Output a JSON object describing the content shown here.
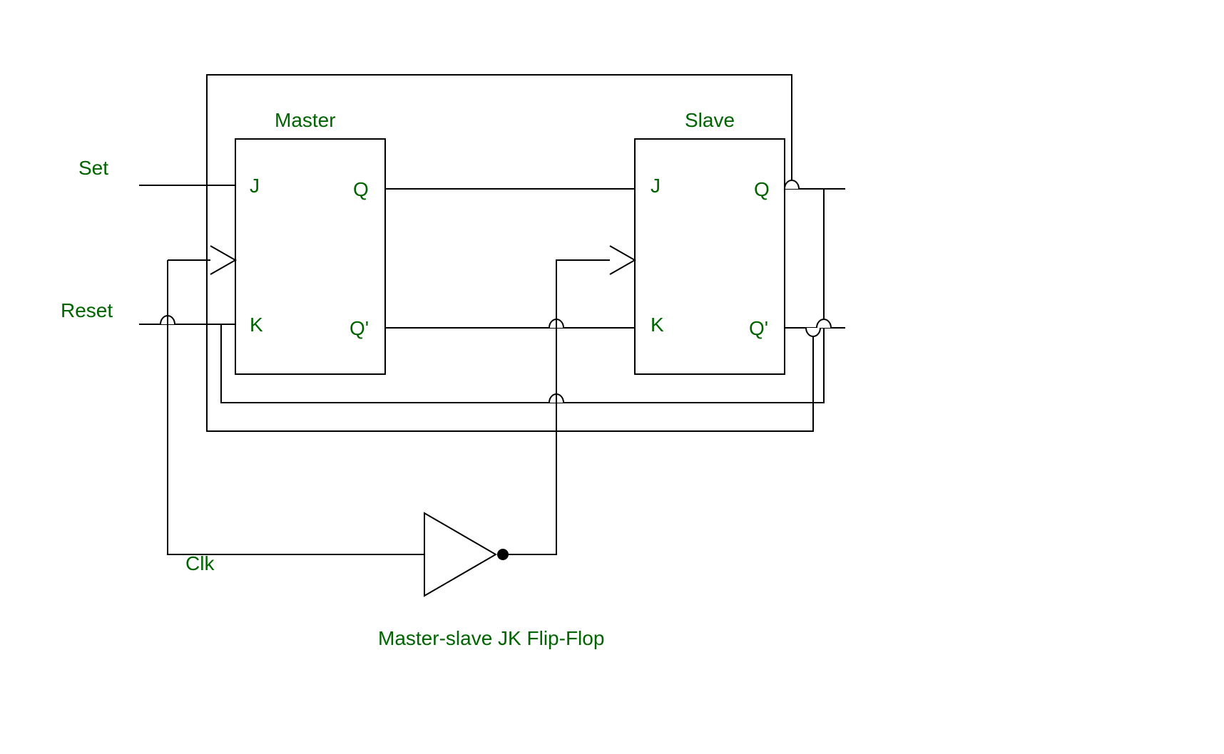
{
  "diagram": {
    "title": "Master-slave JK Flip-Flop",
    "inputs": {
      "set": "Set",
      "reset": "Reset",
      "clk": "Clk"
    },
    "master": {
      "title": "Master",
      "j": "J",
      "k": "K",
      "q": "Q",
      "qbar": "Q'"
    },
    "slave": {
      "title": "Slave",
      "j": "J",
      "k": "K",
      "q": "Q",
      "qbar": "Q'"
    }
  }
}
